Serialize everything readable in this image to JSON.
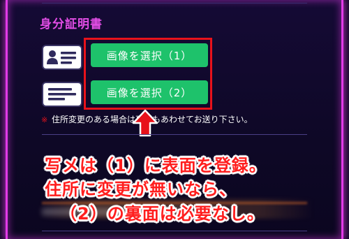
{
  "section": {
    "title": "身分証明書"
  },
  "buttons": {
    "select_1": "画像を選択（1）",
    "select_2": "画像を選択（2）"
  },
  "note": {
    "mark": "※",
    "text": "住所変更のある場合は裏面もあわせてお送り下さい。"
  },
  "overlay_annotation": {
    "line1": "写メは（1）に表面を登録。",
    "line2": "住所に変更が無いなら、",
    "line3": "（2）の裏面は必要なし。"
  },
  "colors": {
    "accent_pink": "#e24de6",
    "button_green": "#1ec26b",
    "annotation_red": "#ff1e1e",
    "highlight_box": "#e8121b"
  },
  "icons": {
    "id_card_front": "id-card-front-icon",
    "id_card_back": "id-card-back-icon",
    "arrow": "up-arrow-icon"
  }
}
